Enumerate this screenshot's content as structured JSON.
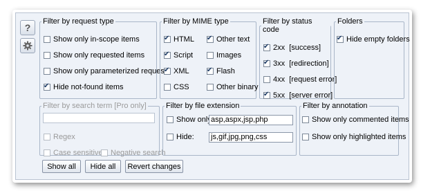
{
  "side": {
    "help": "?",
    "settings_icon": "gear-icon"
  },
  "request_type": {
    "title": "Filter by request type",
    "items": [
      {
        "label": "Show only in-scope items",
        "checked": false
      },
      {
        "label": "Show only requested items",
        "checked": false
      },
      {
        "label": "Show only parameterized requests",
        "checked": false
      },
      {
        "label": "Hide not-found items",
        "checked": true
      }
    ]
  },
  "mime_type": {
    "title": "Filter by MIME type",
    "items": [
      {
        "label": "HTML",
        "checked": true
      },
      {
        "label": "Other text",
        "checked": true
      },
      {
        "label": "Script",
        "checked": true
      },
      {
        "label": "Images",
        "checked": false
      },
      {
        "label": "XML",
        "checked": true
      },
      {
        "label": "Flash",
        "checked": true
      },
      {
        "label": "CSS",
        "checked": false
      },
      {
        "label": "Other binary",
        "checked": false
      }
    ]
  },
  "status_code": {
    "title": "Filter by status code",
    "items": [
      {
        "label": "2xx  [success]",
        "checked": true
      },
      {
        "label": "3xx  [redirection]",
        "checked": true
      },
      {
        "label": "4xx  [request error]",
        "checked": false
      },
      {
        "label": "5xx  [server error]",
        "checked": true
      }
    ]
  },
  "folders": {
    "title": "Folders",
    "items": [
      {
        "label": "Hide empty folders",
        "checked": true
      }
    ]
  },
  "search": {
    "title": "Filter by search term [Pro only]",
    "value": "",
    "regex": "Regex",
    "case_sensitive": "Case sensitive",
    "negative": "Negative search"
  },
  "file_extension": {
    "title": "Filter by file extension",
    "show_only_label": "Show only:",
    "show_only_value": "asp,aspx,jsp,php",
    "hide_label": "Hide:",
    "hide_value": "js,gif,jpg,png,css"
  },
  "annotation": {
    "title": "Filter by annotation",
    "items": [
      {
        "label": "Show only commented items",
        "checked": false
      },
      {
        "label": "Show only highlighted items",
        "checked": false
      }
    ]
  },
  "buttons": {
    "show_all": "Show all",
    "hide_all": "Hide all",
    "revert": "Revert changes"
  }
}
